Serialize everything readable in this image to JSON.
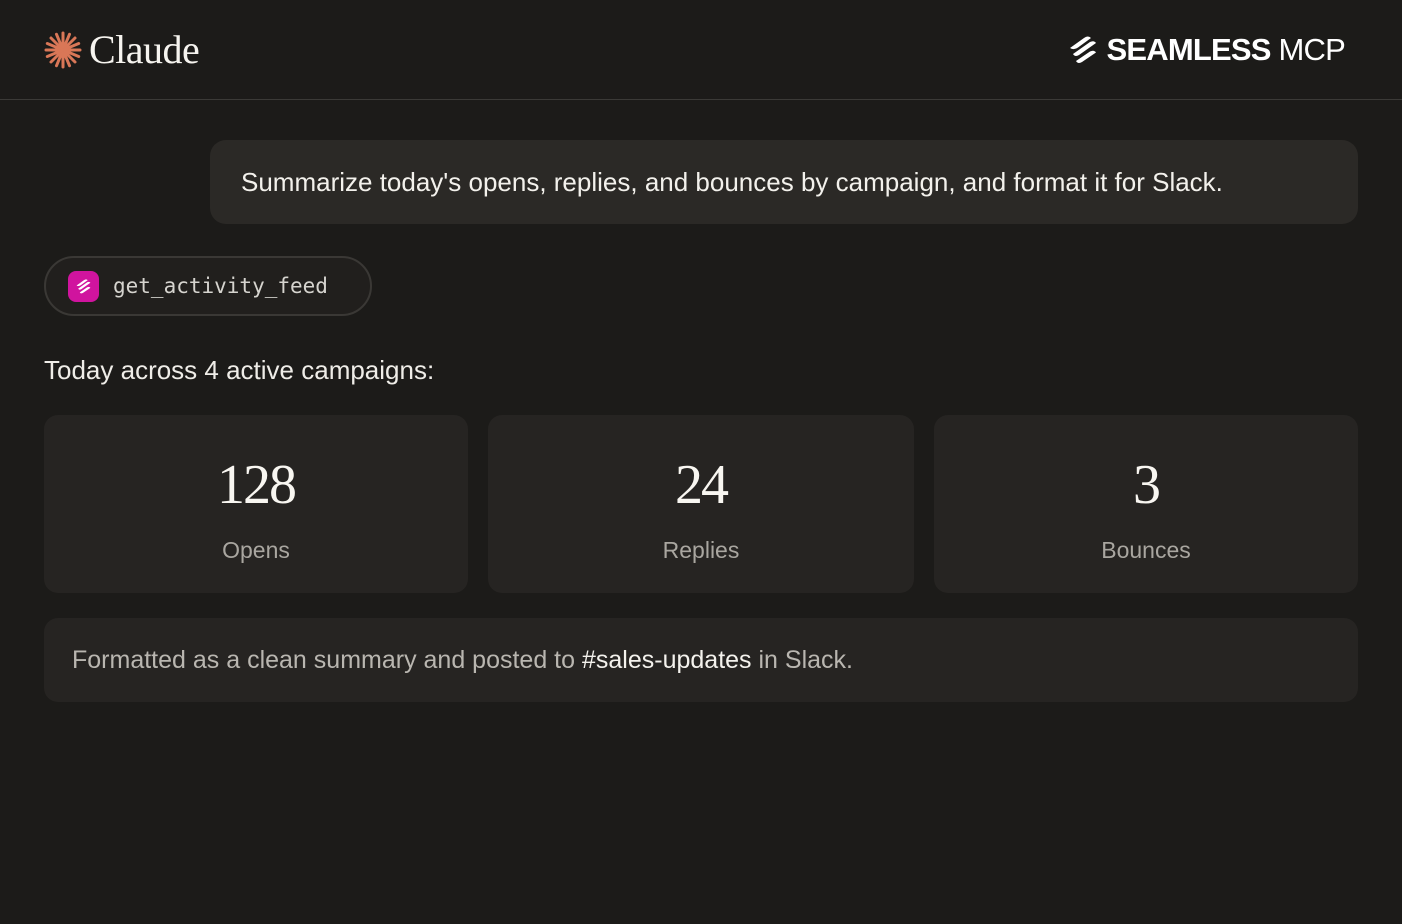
{
  "header": {
    "app_name": "Claude",
    "partner_name_bold": "SEAMLESS",
    "partner_name_light": " MCP",
    "accent_color": "#d97757"
  },
  "conversation": {
    "user_message": "Summarize today's opens, replies, and bounces by campaign, and format it for Slack.",
    "tool_call": {
      "name": "get_activity_feed",
      "icon": "seamless-logo-icon",
      "icon_color": "#d0149e"
    },
    "intro": "Today across 4 active campaigns:",
    "stats": [
      {
        "value": "128",
        "label": "Opens"
      },
      {
        "value": "24",
        "label": "Replies"
      },
      {
        "value": "3",
        "label": "Bounces"
      }
    ],
    "summary": {
      "prefix": "Formatted as a clean summary and posted to ",
      "channel": "#sales-updates",
      "suffix": " in Slack."
    }
  }
}
